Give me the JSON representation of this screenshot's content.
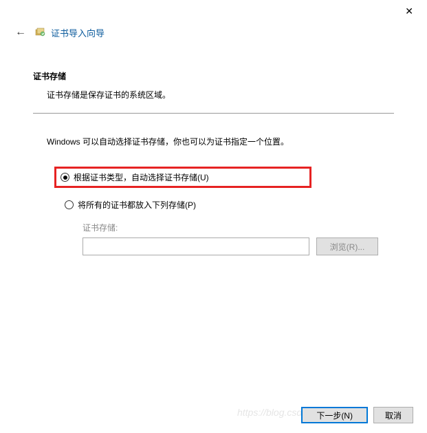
{
  "window": {
    "close_icon": "✕"
  },
  "header": {
    "back_icon": "←",
    "title": "证书导入向导"
  },
  "section": {
    "title": "证书存储",
    "description": "证书存储是保存证书的系统区域。"
  },
  "instruction": "Windows 可以自动选择证书存储，你也可以为证书指定一个位置。",
  "radios": {
    "auto": "根据证书类型，自动选择证书存储(U)",
    "manual": "将所有的证书都放入下列存储(P)"
  },
  "store": {
    "label": "证书存储:",
    "value": "",
    "browse": "浏览(R)..."
  },
  "footer": {
    "next": "下一步(N)",
    "cancel": "取消"
  },
  "watermark": "https://blog.csdn.net/tuxuandy"
}
